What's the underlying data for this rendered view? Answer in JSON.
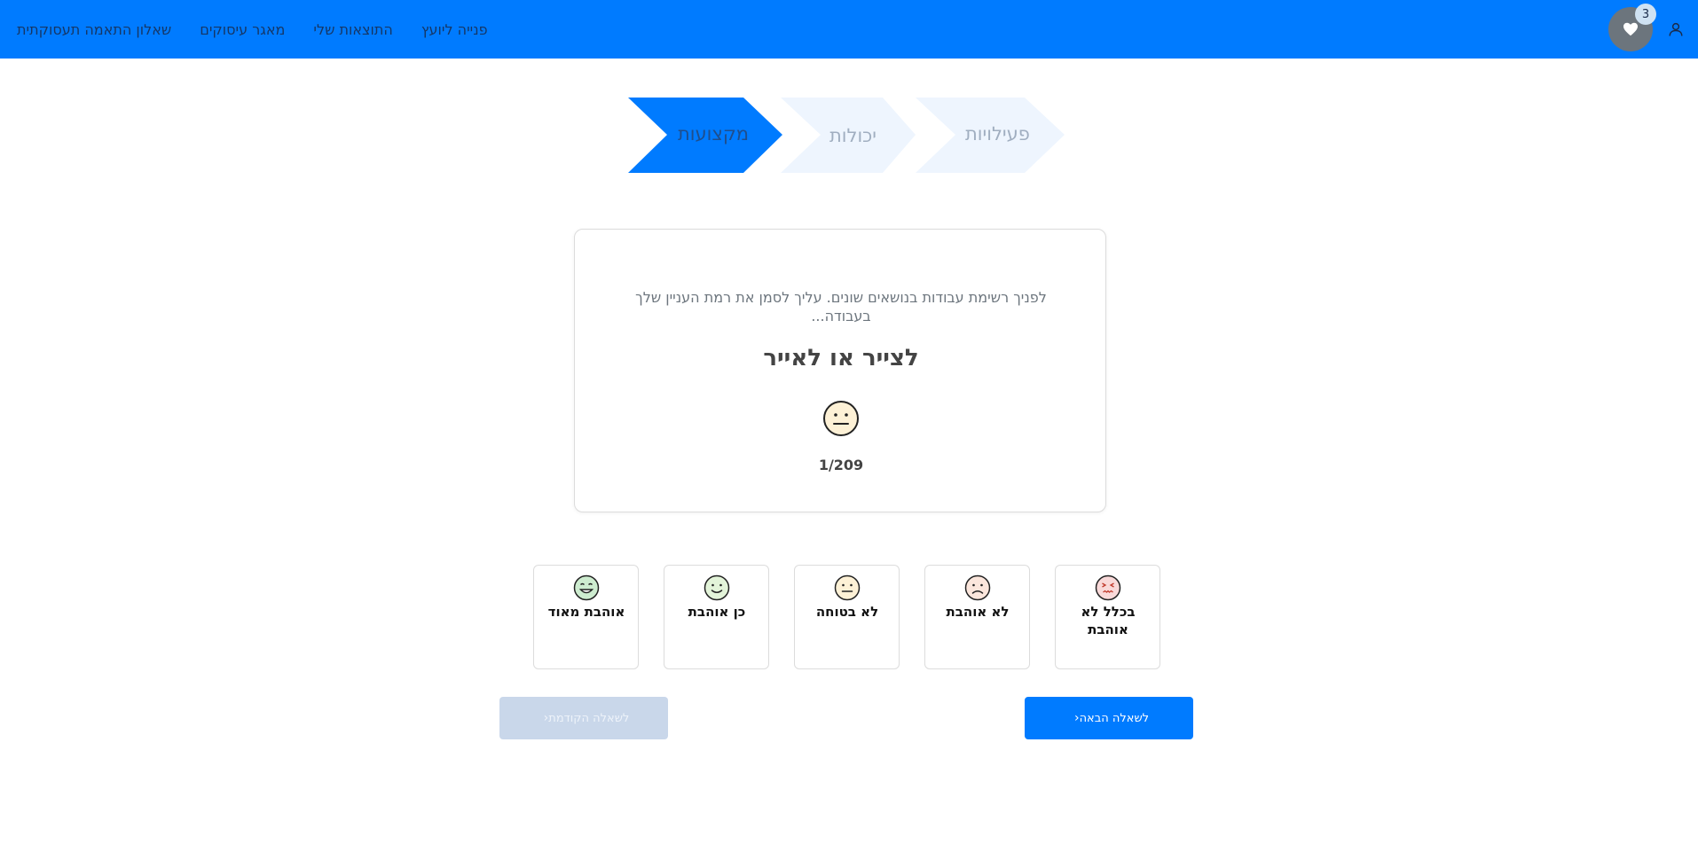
{
  "nav": {
    "links": [
      "שאלון התאמה תעסוקתית",
      "מאגר עיסוקים",
      "התוצאות שלי",
      "פנייה ליועץ"
    ],
    "favorites_count": "3",
    "icons": {
      "favorites": "heart-icon",
      "user": "user-icon"
    }
  },
  "stepper": {
    "steps": [
      {
        "label": "מקצועות",
        "active": true
      },
      {
        "label": "יכולות",
        "active": false
      },
      {
        "label": "פעילויות",
        "active": false
      }
    ]
  },
  "question": {
    "instructions": "לפניך רשימת עבודות בנושאים שונים. עליך לסמן את רמת העניין שלך בעבודה...",
    "title": "לצייר או לאייר",
    "current_face": "neutral-face-icon",
    "counter": "1/209"
  },
  "options": [
    {
      "label": "אוהבת מאוד",
      "icon": "love-face-icon"
    },
    {
      "label": "כן אוהבת",
      "icon": "happy-face-icon"
    },
    {
      "label": "לא בטוחה",
      "icon": "neutral-face-icon"
    },
    {
      "label": "לא אוהבת",
      "icon": "sad-face-icon"
    },
    {
      "label": "בכלל לא אוהבת",
      "icon": "angry-face-icon"
    }
  ],
  "buttons": {
    "next": "לשאלה הבאה",
    "prev": "לשאלה הקודמת"
  },
  "colors": {
    "primary": "#007bff",
    "step_inactive": "#eef5fe",
    "step_inactive_text": "#a0aec0",
    "step_active_text": "#1f4e8c"
  }
}
